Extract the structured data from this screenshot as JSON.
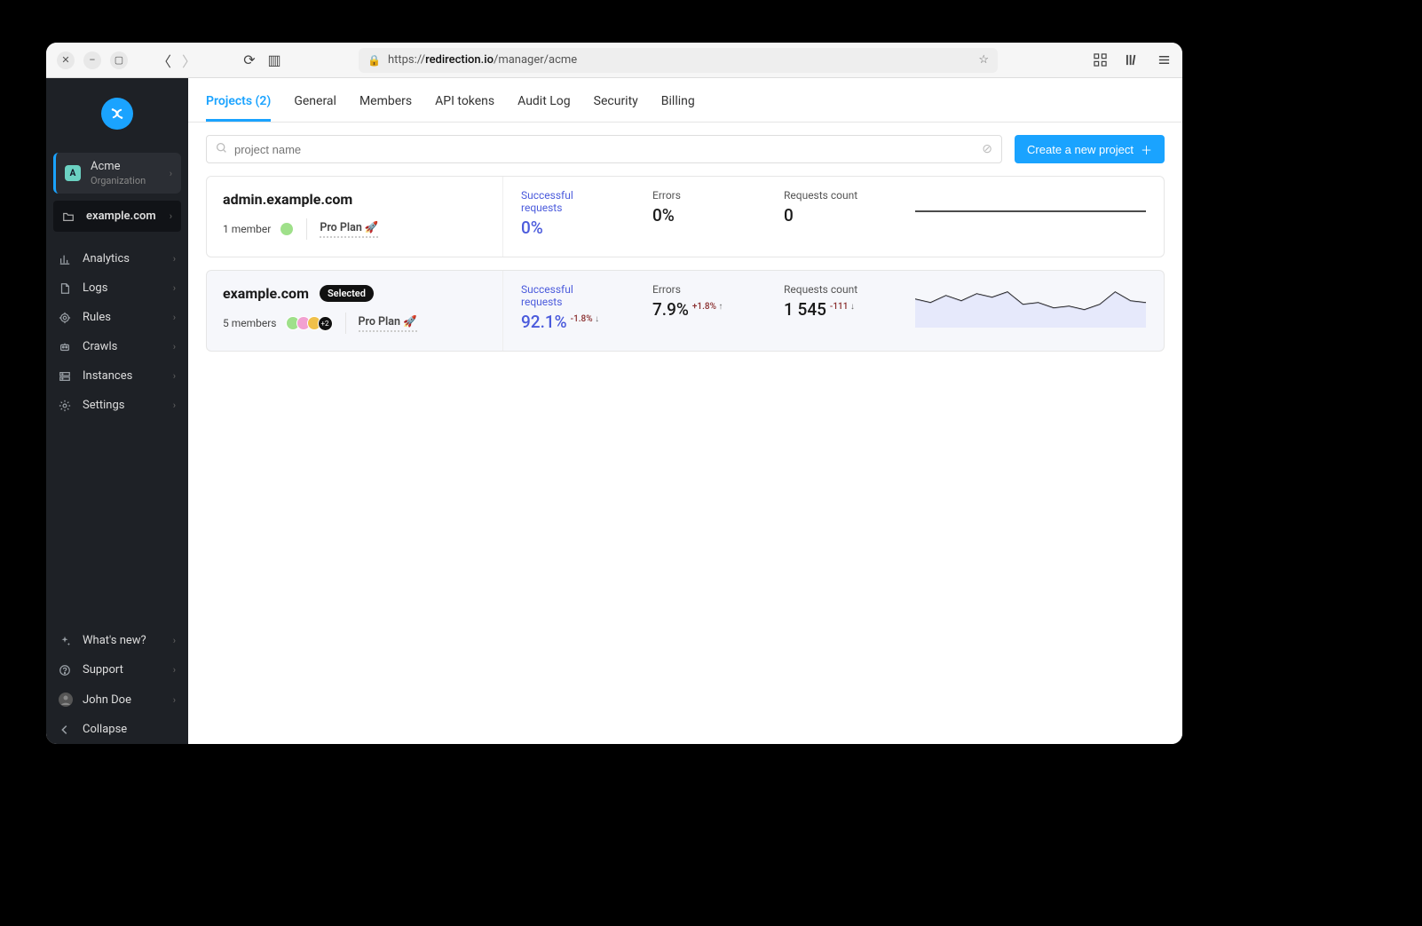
{
  "browser": {
    "url_prefix": "https://",
    "url_domain": "redirection.io",
    "url_path": "/manager/acme"
  },
  "sidebar": {
    "org": {
      "initial": "A",
      "name": "Acme",
      "subtitle": "Organization"
    },
    "project": {
      "name": "example.com"
    },
    "nav": [
      {
        "icon": "chart-icon",
        "label": "Analytics"
      },
      {
        "icon": "file-icon",
        "label": "Logs"
      },
      {
        "icon": "target-icon",
        "label": "Rules"
      },
      {
        "icon": "robot-icon",
        "label": "Crawls"
      },
      {
        "icon": "server-icon",
        "label": "Instances"
      },
      {
        "icon": "gear-icon",
        "label": "Settings"
      }
    ],
    "bottom": [
      {
        "icon": "sparkle-icon",
        "label": "What's new?"
      },
      {
        "icon": "help-icon",
        "label": "Support"
      },
      {
        "icon": "avatar-icon",
        "label": "John Doe"
      },
      {
        "icon": "chevron-left-icon",
        "label": "Collapse"
      }
    ]
  },
  "tabs": [
    {
      "label": "Projects (2)",
      "active": true
    },
    {
      "label": "General"
    },
    {
      "label": "Members"
    },
    {
      "label": "API tokens"
    },
    {
      "label": "Audit Log"
    },
    {
      "label": "Security"
    },
    {
      "label": "Billing"
    }
  ],
  "search": {
    "placeholder": "project name"
  },
  "create_button": "Create a new project",
  "stat_labels": {
    "successful": "Successful requests",
    "errors": "Errors",
    "count": "Requests count"
  },
  "projects": [
    {
      "name": "admin.example.com",
      "selected": false,
      "members_text": "1 member",
      "avatars": 1,
      "avatars_more": null,
      "plan": "Pro Plan 🚀",
      "successful": "0%",
      "successful_delta": null,
      "errors": "0%",
      "errors_delta": null,
      "count": "0",
      "count_delta": null,
      "spark": "flat"
    },
    {
      "name": "example.com",
      "selected": true,
      "selected_badge": "Selected",
      "members_text": "5 members",
      "avatars": 3,
      "avatars_more": "+2",
      "plan": "Pro Plan 🚀",
      "successful": "92.1%",
      "successful_delta": "-1.8%",
      "successful_delta_dir": "down",
      "errors": "7.9%",
      "errors_delta": "+1.8%",
      "errors_delta_dir": "up",
      "count": "1 545",
      "count_delta": "-111",
      "count_delta_dir": "down",
      "spark": "wave"
    }
  ]
}
